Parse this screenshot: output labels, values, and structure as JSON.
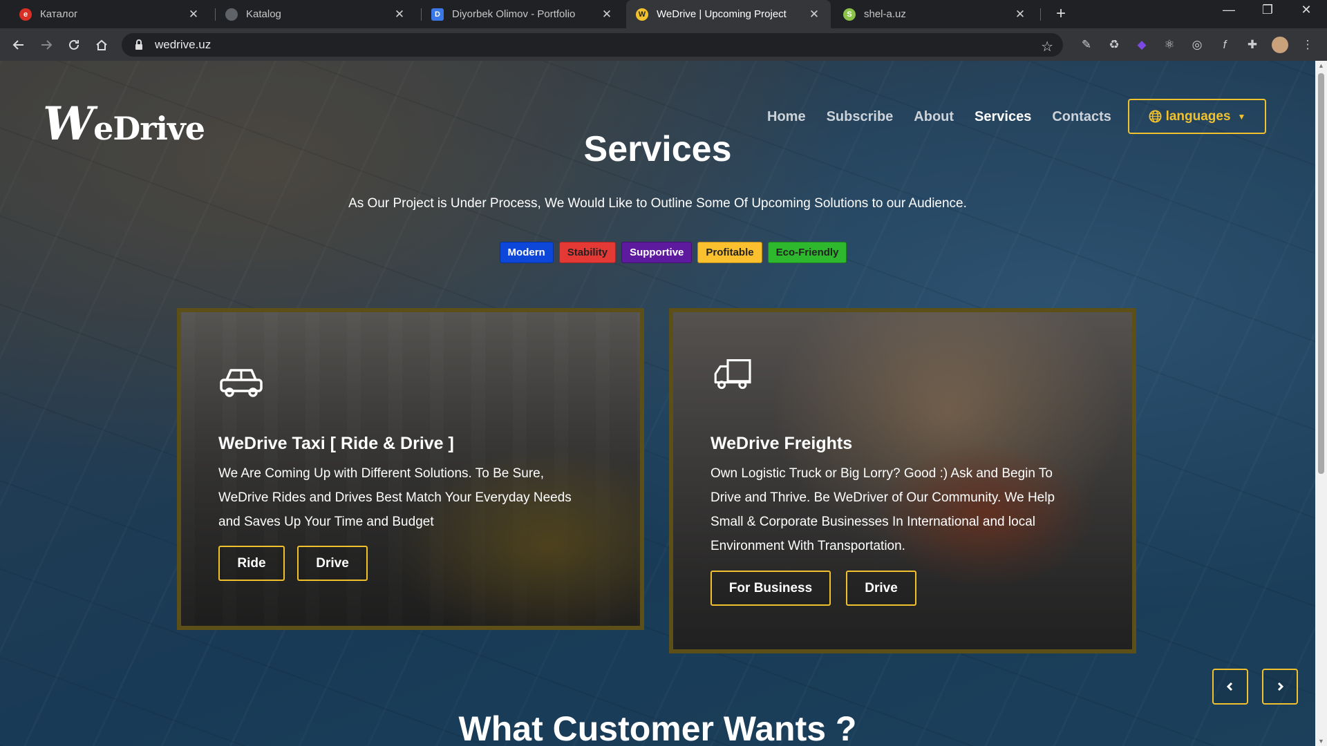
{
  "browser": {
    "tabs": [
      {
        "title": "Каталог",
        "favicon_color": "#d93025",
        "favicon_glyph": "e"
      },
      {
        "title": "Katalog",
        "favicon_color": "#5f6368",
        "favicon_glyph": ""
      },
      {
        "title": "Diyorbek Olimov - Portfolio",
        "favicon_color": "#3b78e7",
        "favicon_glyph": "D"
      },
      {
        "title": "WeDrive | Upcoming Project",
        "favicon_color": "#f2c12e",
        "favicon_glyph": "W"
      },
      {
        "title": "shel-a.uz",
        "favicon_color": "#8bc34a",
        "favicon_glyph": "S"
      }
    ],
    "url": "wedrive.uz"
  },
  "site": {
    "logo_initial": "W",
    "logo_rest": "eDrive",
    "nav": [
      "Home",
      "Subscribe",
      "About",
      "Services",
      "Contacts"
    ],
    "active_nav": "Services",
    "languages_label": "languages",
    "page_title": "Services",
    "subtitle": "As Our Project is Under Process, We Would Like to Outline Some Of Upcoming Solutions to our Audience.",
    "badges": [
      {
        "label": "Modern",
        "bg": "#0d47d9",
        "fg": "#ffffff"
      },
      {
        "label": "Stability",
        "bg": "#e53935",
        "fg": "#222222"
      },
      {
        "label": "Supportive",
        "bg": "#5e1a9e",
        "fg": "#ffffff"
      },
      {
        "label": "Profitable",
        "bg": "#fbc02d",
        "fg": "#222222"
      },
      {
        "label": "Eco-Friendly",
        "bg": "#2eb82e",
        "fg": "#222222"
      }
    ],
    "cards": [
      {
        "icon": "car-icon",
        "title": "WeDrive Taxi [ Ride & Drive ]",
        "lines": [
          "We Are Coming Up with Different Solutions. To Be Sure,",
          "WeDrive Rides and Drives Best Match Your Everyday Needs",
          "and Saves Up Your Time and Budget"
        ],
        "buttons": [
          "Ride",
          "Drive"
        ]
      },
      {
        "icon": "truck-icon",
        "title": "WeDrive Freights",
        "lines": [
          "Own Logistic Truck or Big Lorry? Good :) Ask and Begin To",
          "Drive and Thrive. Be WeDriver of Our Community. We Help",
          "Small & Corporate Businesses In International and local",
          "Environment With Transportation."
        ],
        "buttons": [
          "For Business",
          "Drive"
        ]
      }
    ],
    "next_section_title": "What Customer Wants ?",
    "accent_color": "#f2c12e"
  }
}
